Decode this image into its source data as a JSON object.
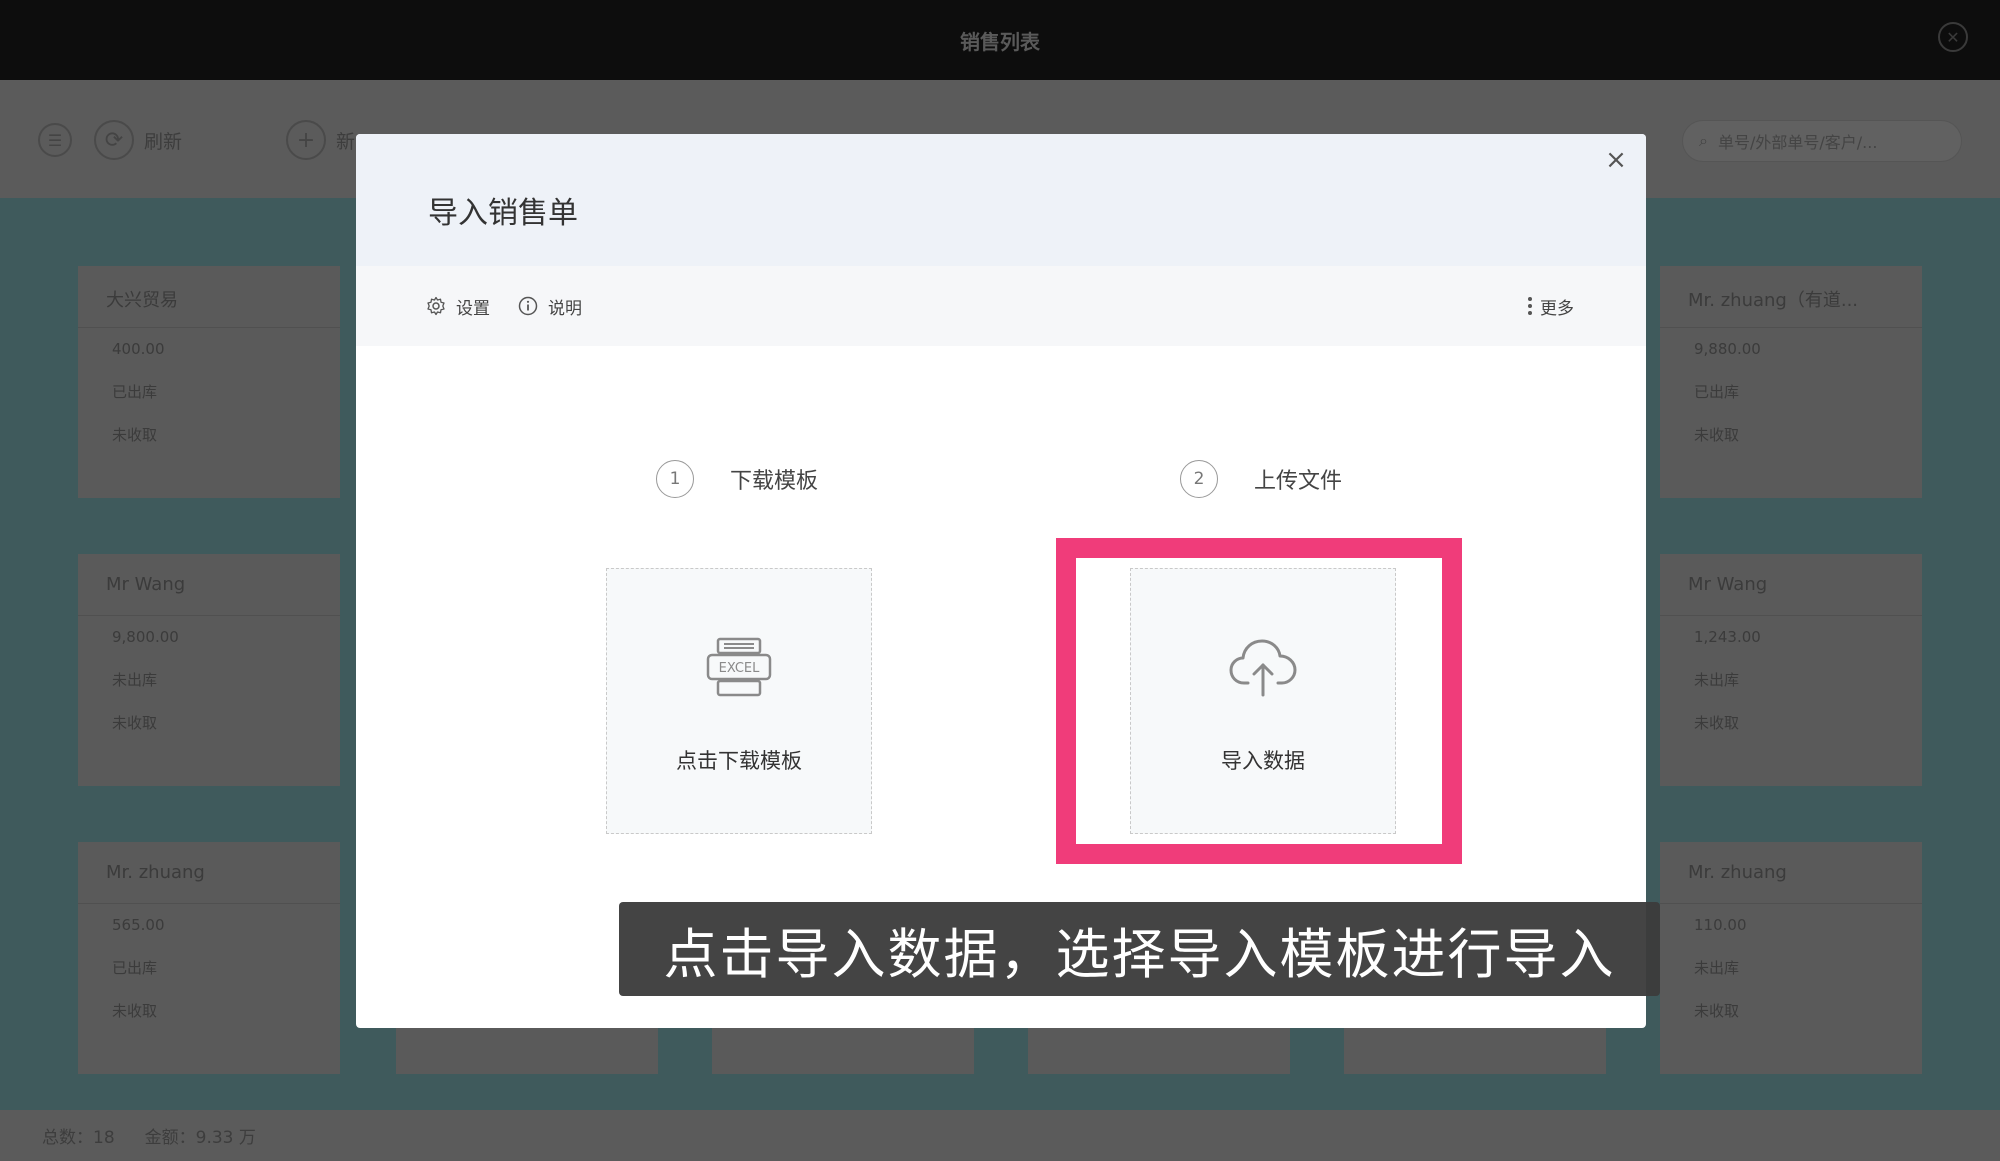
{
  "window": {
    "title": "销售列表"
  },
  "toolbar": {
    "refresh_label": "刷新",
    "add_label": "新",
    "search_placeholder": "单号/外部单号/客户/..."
  },
  "cards": [
    {
      "customer": "大兴贸易",
      "amount": "400.00",
      "stock_status": "已出库",
      "payment_status": "未收取"
    },
    {
      "customer": "Mr Wang",
      "amount": "9,800.00",
      "stock_status": "未出库",
      "payment_status": "未收取"
    },
    {
      "customer": "Mr. zhuang",
      "amount": "565.00",
      "stock_status": "已出库",
      "payment_status": "未收取"
    },
    {
      "customer": "Mr. zhuang（有道...",
      "amount": "9,880.00",
      "stock_status": "已出库",
      "payment_status": "未收取"
    },
    {
      "customer": "Mr Wang",
      "amount": "1,243.00",
      "stock_status": "未出库",
      "payment_status": "未收取"
    },
    {
      "customer": "Mr. zhuang",
      "amount": "110.00",
      "stock_status": "未出库",
      "payment_status": "未收取"
    }
  ],
  "footer": {
    "total_count": "总数：18",
    "total_amount": "金额：9.33 万"
  },
  "modal": {
    "title": "导入销售单",
    "toolbar": {
      "settings_label": "设置",
      "help_label": "说明",
      "more_label": "更多"
    },
    "step1": {
      "number": "1",
      "label": "下载模板",
      "box_label": "点击下载模板",
      "icon_text": "EXCEL"
    },
    "step2": {
      "number": "2",
      "label": "上传文件",
      "box_label": "导入数据"
    }
  },
  "subtitle": "点击导入数据，选择导入模板进行导入",
  "colors": {
    "highlight": "#f03c7a",
    "modal_header": "#eef2f8",
    "overlay_bg": "#3f5a5c"
  }
}
